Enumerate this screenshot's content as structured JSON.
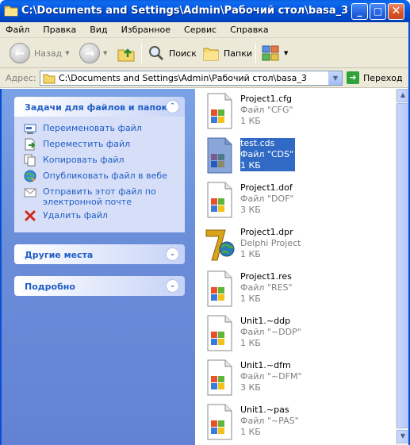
{
  "window": {
    "title": "C:\\Documents and Settings\\Admin\\Рабочий стол\\basa_3",
    "controls": {
      "minimize": "_",
      "maximize": "□",
      "close": "✕"
    }
  },
  "menu": [
    "Файл",
    "Правка",
    "Вид",
    "Избранное",
    "Сервис",
    "Справка"
  ],
  "toolbar": {
    "back_label": "Назад",
    "search_label": "Поиск",
    "folders_label": "Папки"
  },
  "address": {
    "label": "Адрес:",
    "value": "C:\\Documents and Settings\\Admin\\Рабочий стол\\basa_3",
    "go_label": "Переход"
  },
  "tasks_panel": {
    "title": "Задачи для файлов и папок",
    "items": [
      {
        "label": "Переименовать файл",
        "icon": "rename-icon"
      },
      {
        "label": "Переместить файл",
        "icon": "move-icon"
      },
      {
        "label": "Копировать файл",
        "icon": "copy-icon"
      },
      {
        "label": "Опубликовать файл в вебе",
        "icon": "publish-web-icon"
      },
      {
        "label": "Отправить этот файл по электронной почте",
        "icon": "email-icon"
      },
      {
        "label": "Удалить файл",
        "icon": "delete-icon"
      }
    ]
  },
  "other_places_panel": {
    "title": "Другие места"
  },
  "details_panel": {
    "title": "Подробно"
  },
  "files": [
    {
      "name": "Project1.cfg",
      "type": "Файл \"CFG\"",
      "size": "1 КБ",
      "icon": "windows-file-icon",
      "selected": false
    },
    {
      "name": "test.cds",
      "type": "Файл \"CDS\"",
      "size": "1 КБ",
      "icon": "windows-file-icon",
      "selected": true
    },
    {
      "name": "Project1.dof",
      "type": "Файл \"DOF\"",
      "size": "3 КБ",
      "icon": "windows-file-icon",
      "selected": false
    },
    {
      "name": "Project1.dpr",
      "type": "Delphi Project",
      "size": "1 КБ",
      "icon": "delphi-project-icon",
      "selected": false
    },
    {
      "name": "Project1.res",
      "type": "Файл \"RES\"",
      "size": "1 КБ",
      "icon": "windows-file-icon",
      "selected": false
    },
    {
      "name": "Unit1.~ddp",
      "type": "Файл \"~DDP\"",
      "size": "1 КБ",
      "icon": "windows-file-icon",
      "selected": false
    },
    {
      "name": "Unit1.~dfm",
      "type": "Файл \"~DFM\"",
      "size": "3 КБ",
      "icon": "windows-file-icon",
      "selected": false
    },
    {
      "name": "Unit1.~pas",
      "type": "Файл \"~PAS\"",
      "size": "1 КБ",
      "icon": "windows-file-icon",
      "selected": false
    }
  ],
  "colors": {
    "title_blue": "#0050d8",
    "panel_bg": "#6b8ed9",
    "link_blue": "#215dc6",
    "selection": "#316ac5"
  }
}
